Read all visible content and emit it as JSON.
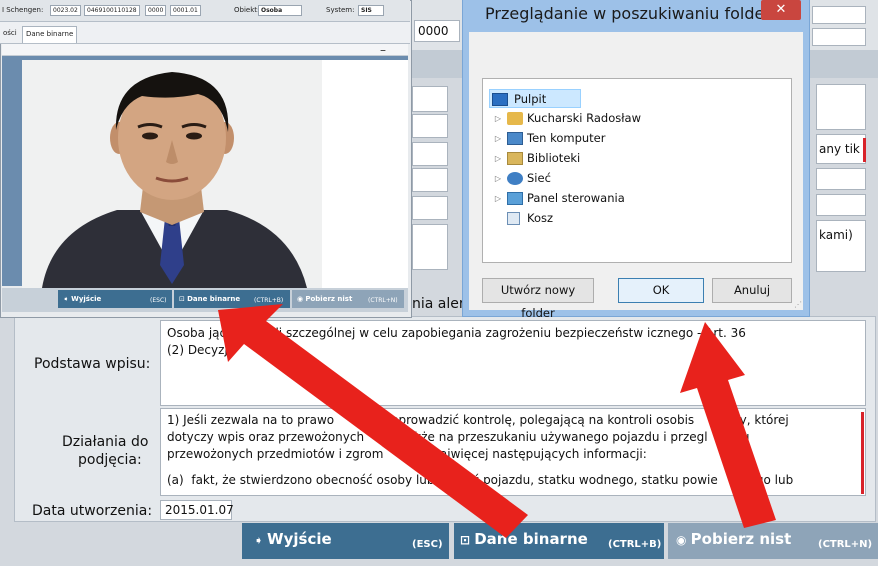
{
  "viewer": {
    "schengen_label": "I Schengen:",
    "schengen_fields": [
      "0023.02",
      "0469100110128",
      "0000",
      "0001.01"
    ],
    "obiekt_label": "Obiekt:",
    "obiekt_value": "Osoba",
    "system_label": "System:",
    "system_value": "SIS",
    "tab_partial": "ości",
    "tab_active": "Dane binarne",
    "minimize": "–",
    "btn_exit": "Wyjście",
    "btn_exit_key": "(ESC)",
    "btn_binary": "Dane binarne",
    "btn_binary_key": "(CTRL+B)",
    "btn_nist": "Pobierz nist",
    "btn_nist_key": "(CTRL+N)"
  },
  "main": {
    "top_field_value": "0000",
    "right_partial_1": "any tik",
    "right_partial_2": "kami)",
    "alert_partial": "nia aler",
    "podstawa_label": "Podstawa wpisu:",
    "podstawa_lines": [
      "Osoba       jąca kontroli szczególnej w celu zapobiegania zagrożeniu bezpieczeństw       icznego - Art. 36",
      "(2) Decyzji"
    ],
    "dzialania_label_1": "Działania do",
    "dzialania_label_2": "podjęcia:",
    "dzialania_lines": [
      "1) Jeśli zezwala na to prawo          przeprowadzić kontrolę, polegającą na kontroli osobis        oby, której",
      "dotyczy wpis oraz przewożonych          także na przeszukaniu używanego pojazdu i przegl         u",
      "przewożonych przedmiotów i zgrom          k najwięcej następujących informacji:",
      "",
      "(a)  fakt, że stwierdzono obecność osoby lub          ć pojazdu, statku wodnego, statku powie          go lub"
    ],
    "data_label": "Data utworzenia:",
    "data_value": "2015.01.07",
    "btn_exit": "Wyjście",
    "btn_exit_key": "(ESC)",
    "btn_binary": "Dane binarne",
    "btn_binary_key": "(CTRL+B)",
    "btn_nist": "Pobierz nist",
    "btn_nist_key": "(CTRL+N)"
  },
  "dialog": {
    "title": "Przeglądanie w poszukiwaniu folderu",
    "close": "✕",
    "tree": [
      {
        "label": "Pulpit",
        "icon": "desktop-icon",
        "has_arrow": false,
        "selected": true
      },
      {
        "label": "Kucharski Radosław",
        "icon": "user-folder-icon",
        "has_arrow": true,
        "selected": false
      },
      {
        "label": "Ten komputer",
        "icon": "computer-icon",
        "has_arrow": true,
        "selected": false
      },
      {
        "label": "Biblioteki",
        "icon": "libraries-icon",
        "has_arrow": true,
        "selected": false
      },
      {
        "label": "Sieć",
        "icon": "network-icon",
        "has_arrow": true,
        "selected": false
      },
      {
        "label": "Panel sterowania",
        "icon": "control-panel-icon",
        "has_arrow": true,
        "selected": false
      },
      {
        "label": "Kosz",
        "icon": "recycle-bin-icon",
        "has_arrow": false,
        "selected": false
      }
    ],
    "new_folder": "Utwórz nowy folder",
    "ok": "OK",
    "cancel": "Anuluj"
  },
  "colors": {
    "arrow": "#e8221c",
    "button_dark": "#3d6e91",
    "button_gray": "#8ea4b8",
    "dialog_frame": "#9dc1e8",
    "close_red": "#c9463f"
  }
}
